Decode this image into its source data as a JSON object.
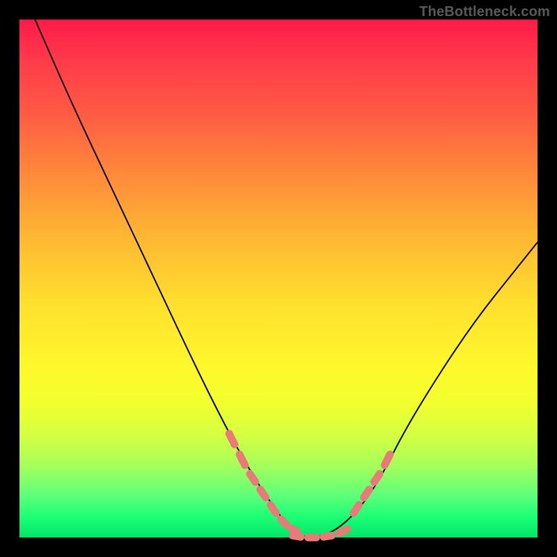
{
  "watermark": "TheBottleneck.com",
  "chart_data": {
    "type": "line",
    "title": "",
    "xlabel": "",
    "ylabel": "",
    "xlim": [
      0,
      100
    ],
    "ylim": [
      0,
      100
    ],
    "grid": false,
    "legend": false,
    "series": [
      {
        "name": "bottleneck-curve",
        "color": "#000000",
        "x": [
          3,
          10,
          18,
          26,
          34,
          40,
          45,
          49,
          52,
          55,
          58,
          62,
          66,
          70,
          74,
          80,
          88,
          96,
          100
        ],
        "y": [
          100,
          84,
          67,
          50,
          33,
          21,
          12,
          6,
          2,
          0,
          0,
          2,
          6,
          12,
          20,
          30,
          42,
          52,
          57
        ]
      },
      {
        "name": "left-highlight-dashes",
        "color": "#e97a7a",
        "style": "dashed",
        "x": [
          40,
          42,
          44,
          46,
          48,
          50,
          52,
          54
        ],
        "y": [
          21,
          17,
          13,
          10,
          7,
          4,
          2,
          1
        ]
      },
      {
        "name": "right-highlight-dashes",
        "color": "#e97a7a",
        "style": "dashed",
        "x": [
          64,
          66,
          68,
          70,
          72
        ],
        "y": [
          4,
          7,
          10,
          13,
          17
        ]
      },
      {
        "name": "bottom-highlight-dashes",
        "color": "#e97a7a",
        "style": "dashed",
        "x": [
          52,
          55,
          58,
          61,
          64
        ],
        "y": [
          0.5,
          0,
          0,
          0.5,
          2
        ]
      }
    ]
  }
}
